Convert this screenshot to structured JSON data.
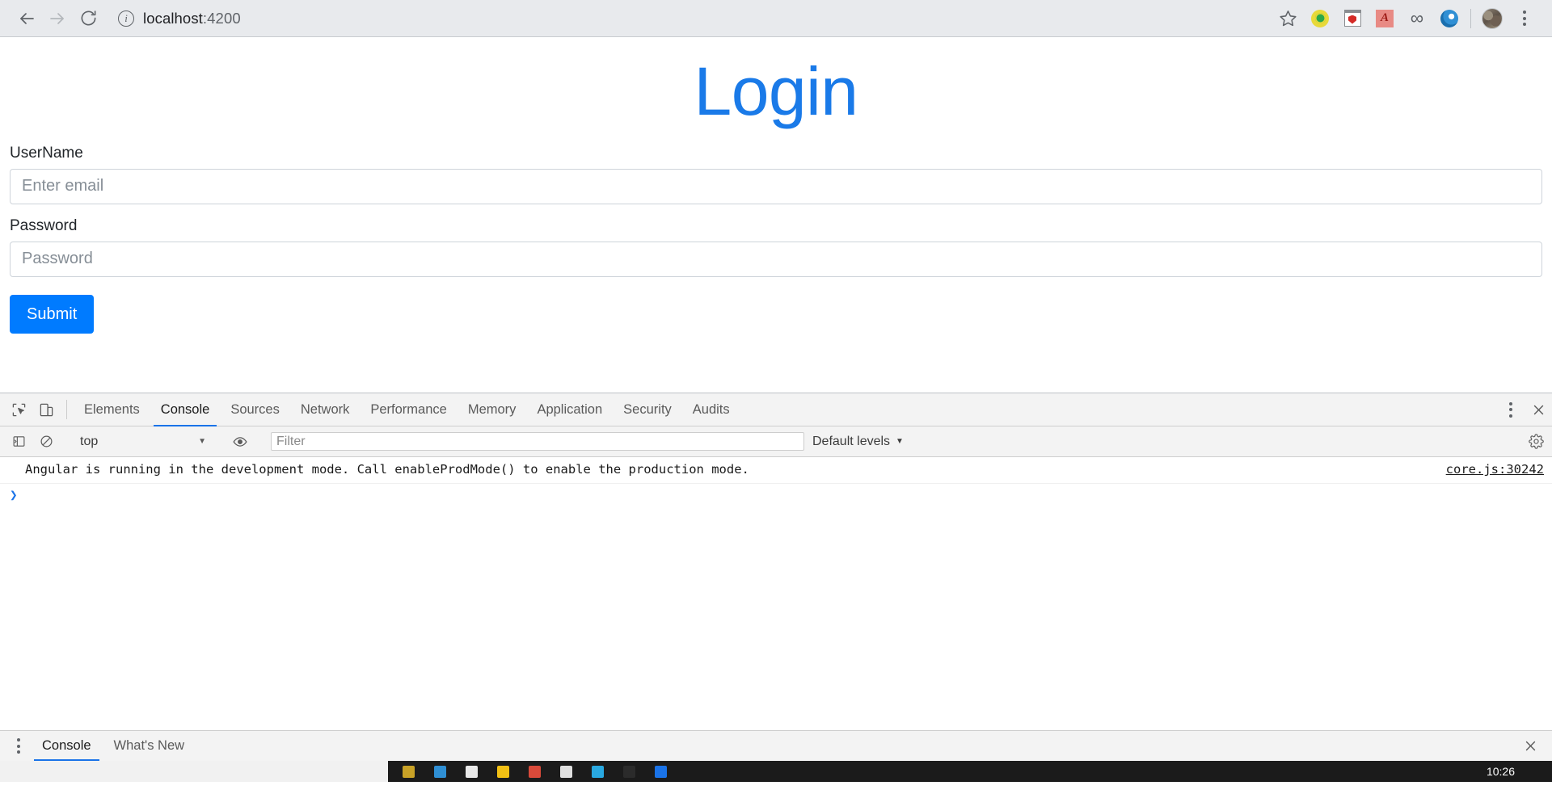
{
  "browser": {
    "back_icon": "back-arrow-icon",
    "forward_icon": "forward-arrow-icon",
    "reload_icon": "reload-icon",
    "info_icon": "info-circle-icon",
    "url_host": "localhost",
    "url_port": ":4200",
    "bookmark_icon": "star-icon",
    "extensions": [
      {
        "name": "extension-green-plus-icon",
        "label": ""
      },
      {
        "name": "extension-shield-icon",
        "label": ""
      },
      {
        "name": "extension-acrobat-icon",
        "label": "A"
      },
      {
        "name": "extension-infinity-icon",
        "label": "∞"
      },
      {
        "name": "extension-blue-swirl-icon",
        "label": ""
      }
    ],
    "profile_icon": "profile-avatar",
    "menu_icon": "chrome-menu-icon"
  },
  "page": {
    "title": "Login",
    "title_color": "#1a7ae8",
    "username_label": "UserName",
    "username_placeholder": "Enter email",
    "username_value": "",
    "password_label": "Password",
    "password_placeholder": "Password",
    "password_value": "",
    "submit_label": "Submit",
    "submit_color": "#007bff"
  },
  "devtools": {
    "inspect_icon": "inspect-element-icon",
    "device_icon": "device-toolbar-icon",
    "tabs": [
      {
        "label": "Elements",
        "active": false
      },
      {
        "label": "Console",
        "active": true
      },
      {
        "label": "Sources",
        "active": false
      },
      {
        "label": "Network",
        "active": false
      },
      {
        "label": "Performance",
        "active": false
      },
      {
        "label": "Memory",
        "active": false
      },
      {
        "label": "Application",
        "active": false
      },
      {
        "label": "Security",
        "active": false
      },
      {
        "label": "Audits",
        "active": false
      }
    ],
    "more_icon": "devtools-more-icon",
    "close_icon": "devtools-close-icon",
    "console_toolbar": {
      "sidebar_icon": "console-sidebar-icon",
      "clear_icon": "clear-console-icon",
      "context": "top",
      "context_caret": "▼",
      "eye_icon": "live-expression-eye-icon",
      "filter_placeholder": "Filter",
      "filter_value": "",
      "levels": "Default levels",
      "levels_caret": "▼",
      "settings_icon": "settings-gear-icon"
    },
    "messages": [
      {
        "text": "Angular is running in the development mode. Call enableProdMode() to enable the production mode.",
        "source": "core.js:30242"
      }
    ],
    "prompt_symbol": "❯",
    "drawer": {
      "menu_icon": "drawer-menu-icon",
      "tabs": [
        {
          "label": "Console",
          "active": true
        },
        {
          "label": "What's New",
          "active": false
        }
      ],
      "close_icon": "drawer-close-icon"
    }
  },
  "taskbar": {
    "clock": "10:26",
    "apps": [
      "#c9a227",
      "#2f8fd4",
      "#e8e8e8",
      "#f2c014",
      "#d94a3a",
      "#dfdfdf",
      "#29a8e0",
      "#2b2b2b",
      "#1a73e8"
    ]
  }
}
